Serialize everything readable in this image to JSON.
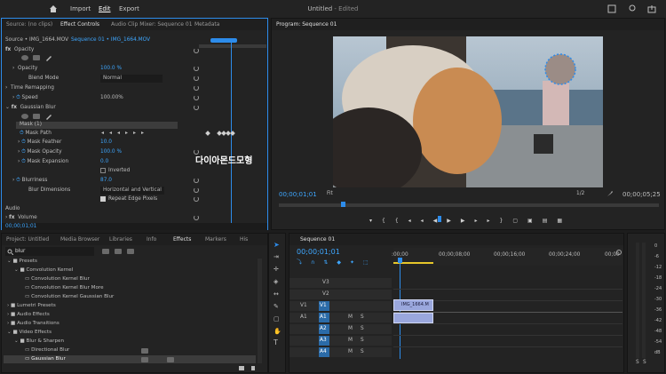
{
  "topbar": {
    "home": "home-icon",
    "import": "Import",
    "edit": "Edit",
    "export": "Export",
    "title": "Untitled",
    "edited": " - Edited"
  },
  "source_panel": {
    "tabs": [
      "Source: (no clips)",
      "Effect Controls",
      "Audio Clip Mixer: Sequence 01",
      "Metadata"
    ],
    "source_label": "Source • IMG_1664.MOV",
    "seq_label": "Sequence 01 • IMG_1664.MOV",
    "rows": {
      "opacity_header": "Opacity",
      "opacity": "Opacity",
      "opacity_val": "100.0 %",
      "blend": "Blend Mode",
      "blend_val": "Normal",
      "time_remap": "Time Remapping",
      "speed": "Speed",
      "speed_val": "100.00%",
      "gaussian": "Gaussian Blur",
      "mask1": "Mask (1)",
      "mask_path": "Mask Path",
      "mask_feather": "Mask Feather",
      "mask_feather_val": "10.0",
      "mask_opacity": "Mask Opacity",
      "mask_opacity_val": "100.0 %",
      "mask_expansion": "Mask Expansion",
      "mask_expansion_val": "0.0",
      "inverted": "Inverted",
      "blurriness": "Blurriness",
      "blurriness_val": "87.0",
      "blur_dims": "Blur Dimensions",
      "blur_dims_val": "Horizontal and Vertical",
      "repeat": "Repeat Edge Pixels",
      "audio": "Audio",
      "volume": "Volume"
    },
    "timecode": "00;00;01;01",
    "overlay": "다이아몬드모형"
  },
  "program": {
    "title": "Program: Sequence 01",
    "timecode": "00;00;01;01",
    "fit": "Fit",
    "ratio": "1/2",
    "duration": "00;00;05;25"
  },
  "project_panel": {
    "tabs": [
      "Project: Untitled",
      "Media Browser",
      "Libraries",
      "Info",
      "Effects",
      "Markers",
      "His"
    ],
    "search": "blur",
    "items": [
      "Presets",
      "Convolution Kernel",
      "Convolution Kernel Blur",
      "Convolution Kernel Blur More",
      "Convolution Kernel Gaussian Blur",
      "Lumetri Presets",
      "Audio Effects",
      "Audio Transitions",
      "Video Effects",
      "Blur & Sharpen",
      "Directional Blur",
      "Gaussian Blur"
    ]
  },
  "timeline": {
    "tab": "Sequence 01",
    "timecode": "00;00;01;01",
    "ruler": [
      ":00;00",
      "00;00;08;00",
      "00;00;16;00",
      "00;00;24;00",
      "00;00"
    ],
    "tracks": [
      "V3",
      "V2",
      "V1",
      "A1",
      "A2",
      "A3",
      "A4"
    ],
    "clip_label": "IMG_1664.M",
    "m": "M",
    "s": "S",
    "v1": "V1",
    "a1": "A1"
  },
  "meter": {
    "labels": [
      "0",
      "-6",
      "-12",
      "-18",
      "-24",
      "-30",
      "-36",
      "-42",
      "-48",
      "-54",
      "dB"
    ],
    "s1": "S",
    "s2": "S"
  },
  "colors": {
    "accent": "#2d8ceb",
    "timecode": "#3ea7ff",
    "clip": "#9aa7dd"
  }
}
